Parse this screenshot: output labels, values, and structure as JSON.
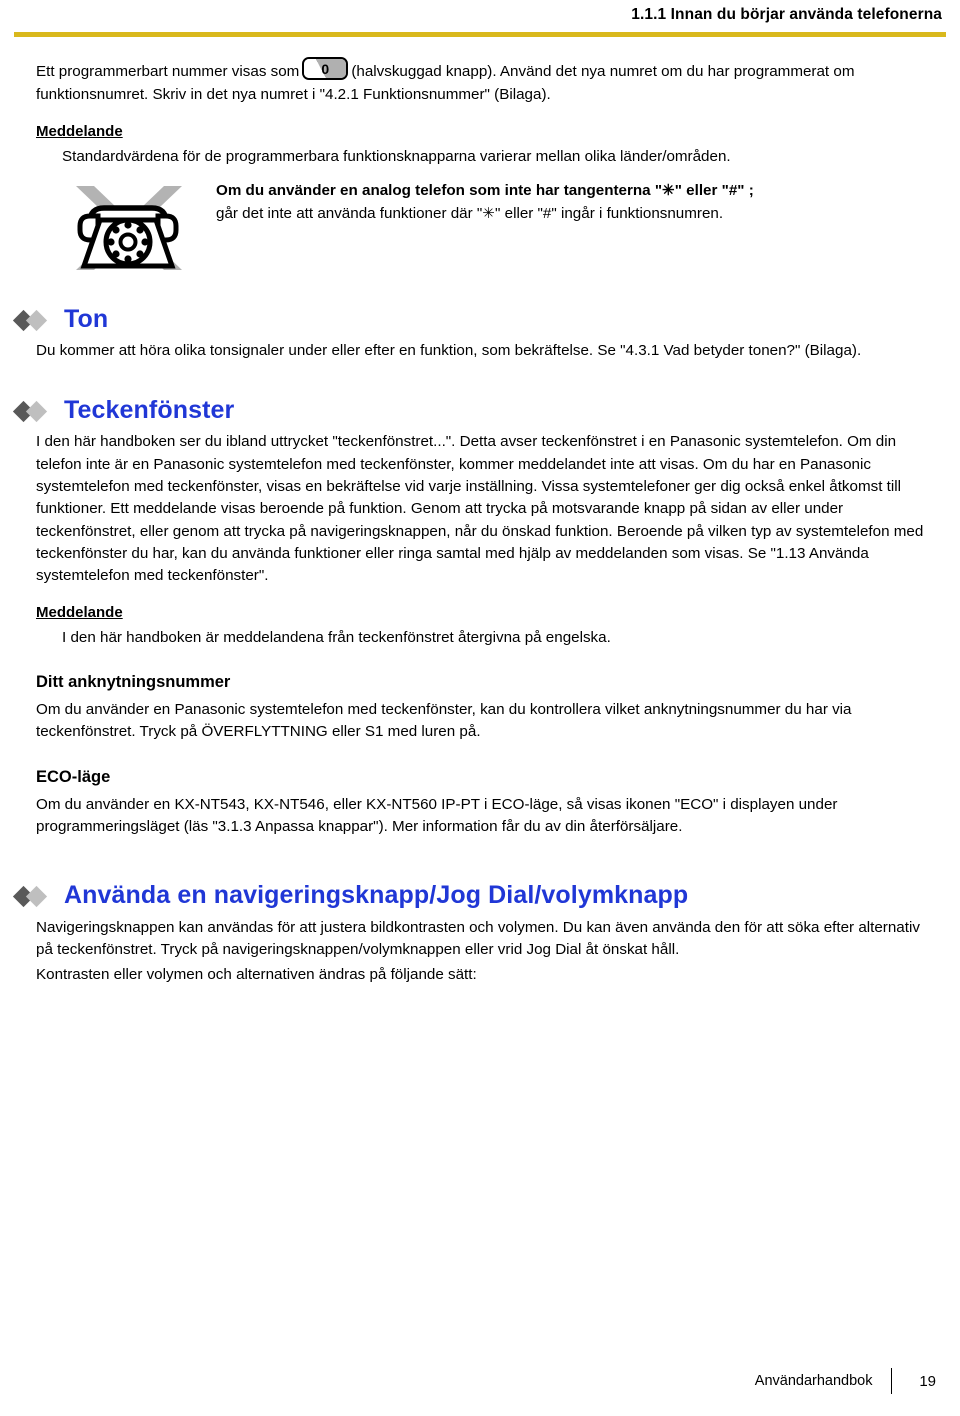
{
  "header": {
    "title": "1.1.1 Innan du börjar använda telefonerna",
    "rule_color": "#d9b81c"
  },
  "intro": {
    "text_before_key": "Ett programmerbart nummer visas som",
    "keycap_digit": "0",
    "text_after_key": "(halvskuggad knapp). Använd det nya numret om du har programmerat om funktionsnumret. Skriv in det nya numret i \"4.2.1  Funktionsnummer\" (Bilaga)."
  },
  "note_1": {
    "label": "Meddelande",
    "body": "Standardvärdena för de programmerbara funktionsknapparna varierar mellan olika länder/områden."
  },
  "caution": {
    "icon": "analog-phone-prohibited-icon",
    "line1": "Om du använder en analog telefon som inte har tangenterna \"✳\" eller \"#\" ;",
    "line2": "går det inte att använda funktioner där \"✳\" eller \"#\" ingår i funktionsnumren."
  },
  "section_ton": {
    "title": "Ton",
    "body": "Du kommer att höra olika tonsignaler under eller efter en funktion, som bekräftelse. Se \"4.3.1  Vad betyder tonen?\" (Bilaga)."
  },
  "section_teckenfonster": {
    "title": "Teckenfönster",
    "body": "I den här handboken ser du ibland uttrycket \"teckenfönstret...\". Detta avser teckenfönstret i en Panasonic systemtelefon. Om din telefon inte är en Panasonic systemtelefon med teckenfönster, kommer meddelandet inte att visas. Om du har en Panasonic systemtelefon med teckenfönster, visas en bekräftelse vid varje inställning. Vissa systemtelefoner ger dig också enkel åtkomst till funktioner. Ett meddelande visas beroende på funktion. Genom att trycka på motsvarande knapp på sidan av eller under teckenfönstret, eller genom att trycka på navigeringsknappen, når du önskad funktion. Beroende på vilken typ av systemtelefon med teckenfönster du har, kan du använda funktioner eller ringa samtal med hjälp av meddelanden som visas. Se \"1.13  Använda systemtelefon med teckenfönster\".",
    "note_label": "Meddelande",
    "note_body": "I den här handboken är meddelandena från teckenfönstret återgivna på engelska.",
    "sub1_title": "Ditt anknytningsnummer",
    "sub1_body": "Om du använder en Panasonic systemtelefon med teckenfönster, kan du kontrollera vilket anknytningsnummer du har via teckenfönstret. Tryck på ÖVERFLYTTNING eller S1 med luren på.",
    "sub2_title": "ECO-läge",
    "sub2_body": "Om du använder en KX-NT543, KX-NT546, eller KX-NT560 IP-PT i ECO-läge, så visas ikonen \"ECO\" i displayen under programmeringsläget (läs \"3.1.3  Anpassa knappar\"). Mer information får du av din återförsäljare."
  },
  "section_navigering": {
    "title": "Använda en navigeringsknapp/Jog Dial/volymknapp",
    "body1": "Navigeringsknappen kan användas för att justera bildkontrasten och volymen. Du kan även använda den för att söka efter alternativ på teckenfönstret. Tryck på navigeringsknappen/volymknappen eller vrid Jog Dial åt önskat håll.",
    "body2": "Kontrasten eller volymen och alternativen ändras på följande sätt:"
  },
  "footer": {
    "label": "Användarhandbok",
    "page": "19"
  },
  "colors": {
    "heading_blue": "#2037d6",
    "rule_gold": "#d9b81c",
    "diamond_dark": "#595959",
    "diamond_light": "#bfbfbf"
  }
}
